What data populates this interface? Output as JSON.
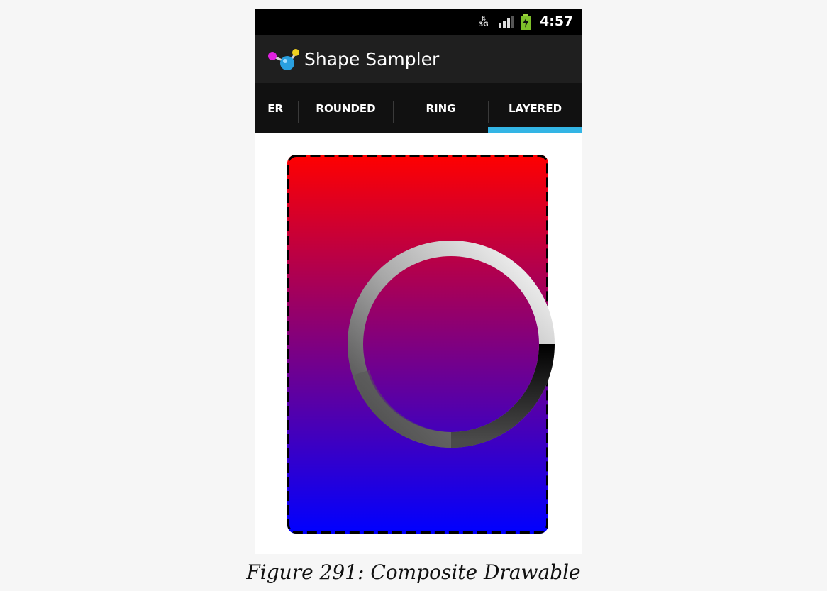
{
  "status_bar": {
    "network_label": "3G",
    "time": "4:57",
    "icons": [
      "network-3g-icon",
      "signal-icon",
      "battery-charging-icon"
    ]
  },
  "action_bar": {
    "app_icon": "shape-sampler-app-icon",
    "title": "Shape Sampler"
  },
  "tabs": [
    {
      "label": "ER",
      "selected": false
    },
    {
      "label": "ROUNDED",
      "selected": false
    },
    {
      "label": "RING",
      "selected": false
    },
    {
      "label": "LAYERED",
      "selected": true
    }
  ],
  "colors": {
    "accent": "#33b5e5",
    "gradient_top": "#ff0000",
    "gradient_bottom": "#0000ff"
  },
  "caption": "Figure 291: Composite Drawable"
}
